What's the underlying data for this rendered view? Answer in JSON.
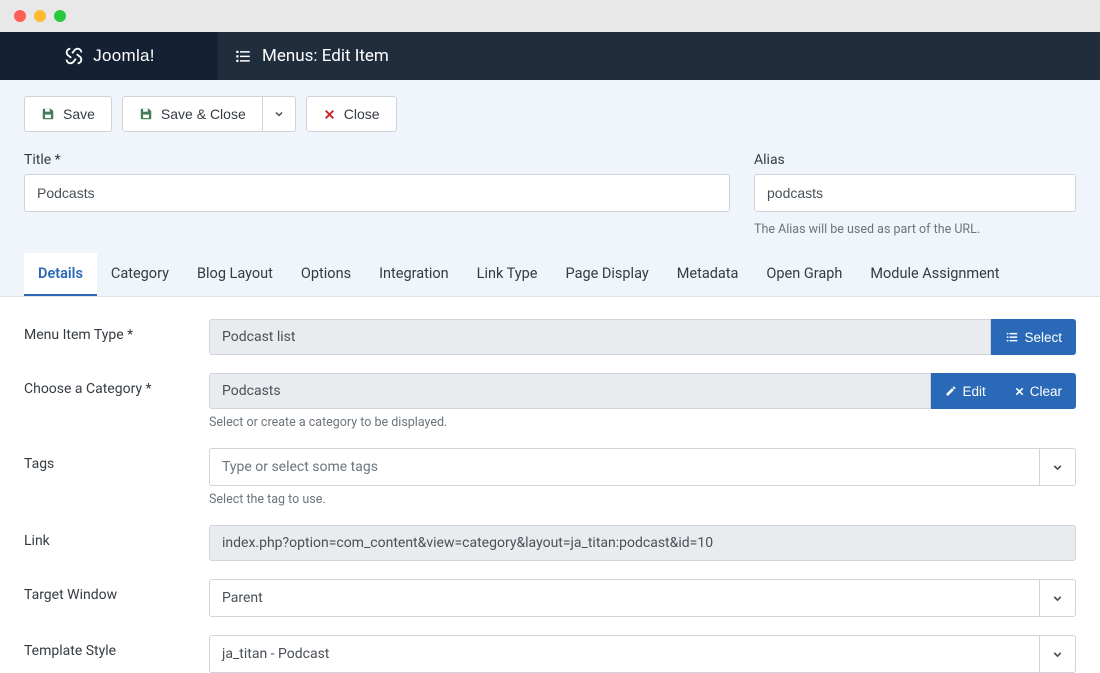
{
  "brand": "Joomla!",
  "page_title": "Menus: Edit Item",
  "toolbar": {
    "save": "Save",
    "save_close": "Save & Close",
    "close": "Close"
  },
  "form": {
    "title_label": "Title *",
    "title_value": "Podcasts",
    "alias_label": "Alias",
    "alias_value": "podcasts",
    "alias_hint": "The Alias will be used as part of the URL."
  },
  "tabs": [
    "Details",
    "Category",
    "Blog Layout",
    "Options",
    "Integration",
    "Link Type",
    "Page Display",
    "Metadata",
    "Open Graph",
    "Module Assignment"
  ],
  "details": {
    "menu_item_type_label": "Menu Item Type *",
    "menu_item_type_value": "Podcast list",
    "select_btn": "Select",
    "category_label": "Choose a Category *",
    "category_value": "Podcasts",
    "edit_btn": "Edit",
    "clear_btn": "Clear",
    "category_hint": "Select or create a category to be displayed.",
    "tags_label": "Tags",
    "tags_placeholder": "Type or select some tags",
    "tags_hint": "Select the tag to use.",
    "link_label": "Link",
    "link_value": "index.php?option=com_content&view=category&layout=ja_titan:podcast&id=10",
    "target_label": "Target Window",
    "target_value": "Parent",
    "template_label": "Template Style",
    "template_value": "ja_titan - Podcast"
  }
}
